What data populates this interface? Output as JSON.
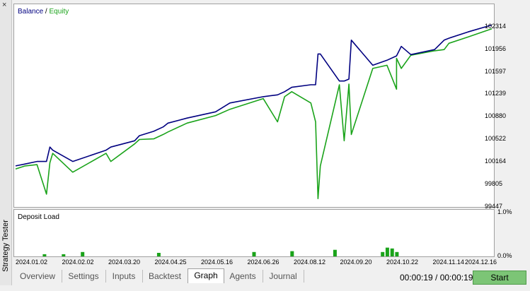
{
  "side_panel": {
    "title": "Strategy Tester",
    "close_glyph": "×"
  },
  "main_chart": {
    "legend_balance": "Balance",
    "legend_sep": " / ",
    "legend_equity": "Equity",
    "colors": {
      "balance": "#000080",
      "equity": "#1aa31a"
    }
  },
  "load_chart": {
    "title": "Deposit Load",
    "color": "#1aa31a"
  },
  "chart_data": [
    {
      "type": "line",
      "title": "",
      "legend": "top-left",
      "y_ticks": [
        "102314",
        "101956",
        "101597",
        "101239",
        "100880",
        "100522",
        "100164",
        "99805",
        "99447"
      ],
      "ylim": [
        99447,
        102491
      ],
      "x_ticks": [
        "2024.01.02",
        "2024.02.02",
        "2024.03.20",
        "2024.04.25",
        "2024.05.16",
        "2024.06.26",
        "2024.08.12",
        "2024.09.20",
        "2024.10.22",
        "2024.11.14",
        "2024.12.16"
      ],
      "x": [
        0,
        0.02,
        0.045,
        0.065,
        0.072,
        0.078,
        0.12,
        0.19,
        0.2,
        0.25,
        0.26,
        0.29,
        0.31,
        0.32,
        0.36,
        0.42,
        0.45,
        0.52,
        0.55,
        0.565,
        0.58,
        0.62,
        0.63,
        0.635,
        0.64,
        0.68,
        0.69,
        0.7,
        0.705,
        0.75,
        0.78,
        0.8,
        0.8,
        0.81,
        0.83,
        0.88,
        0.9,
        0.91,
        0.95,
        1
      ],
      "series": [
        {
          "name": "Balance",
          "values": [
            100100,
            100130,
            100170,
            100170,
            100400,
            100350,
            100170,
            100350,
            100400,
            100500,
            100580,
            100650,
            100720,
            100780,
            100860,
            100960,
            101100,
            101200,
            101230,
            101280,
            101350,
            101390,
            101390,
            101880,
            101880,
            101450,
            101450,
            101480,
            102100,
            101700,
            101780,
            101850,
            101850,
            102000,
            101870,
            101950,
            102100,
            102130,
            102230,
            102340
          ]
        },
        {
          "name": "Equity",
          "values": [
            100050,
            100100,
            100120,
            99650,
            100150,
            100300,
            100000,
            100300,
            100170,
            100450,
            100520,
            100530,
            100600,
            100640,
            100780,
            100900,
            101000,
            101170,
            100800,
            101200,
            101280,
            101100,
            100800,
            99580,
            100100,
            101390,
            100500,
            101400,
            100600,
            101650,
            101700,
            101320,
            101810,
            101650,
            101860,
            101930,
            101950,
            102050,
            102150,
            102280
          ]
        }
      ]
    },
    {
      "type": "area",
      "title": "Deposit Load",
      "y_ticks": [
        "1.0%",
        "0.0%"
      ],
      "ylim": [
        0,
        1.0
      ],
      "x": [
        0.06,
        0.1,
        0.14,
        0.3,
        0.5,
        0.58,
        0.67,
        0.77,
        0.78,
        0.79,
        0.8
      ],
      "values": [
        0.05,
        0.05,
        0.1,
        0.08,
        0.1,
        0.12,
        0.15,
        0.1,
        0.2,
        0.18,
        0.1
      ]
    }
  ],
  "tabs": [
    {
      "label": "Overview",
      "active": false
    },
    {
      "label": "Settings",
      "active": false
    },
    {
      "label": "Inputs",
      "active": false
    },
    {
      "label": "Backtest",
      "active": false
    },
    {
      "label": "Graph",
      "active": true
    },
    {
      "label": "Agents",
      "active": false
    },
    {
      "label": "Journal",
      "active": false
    }
  ],
  "timer": "00:00:19 / 00:00:19",
  "start_label": "Start"
}
